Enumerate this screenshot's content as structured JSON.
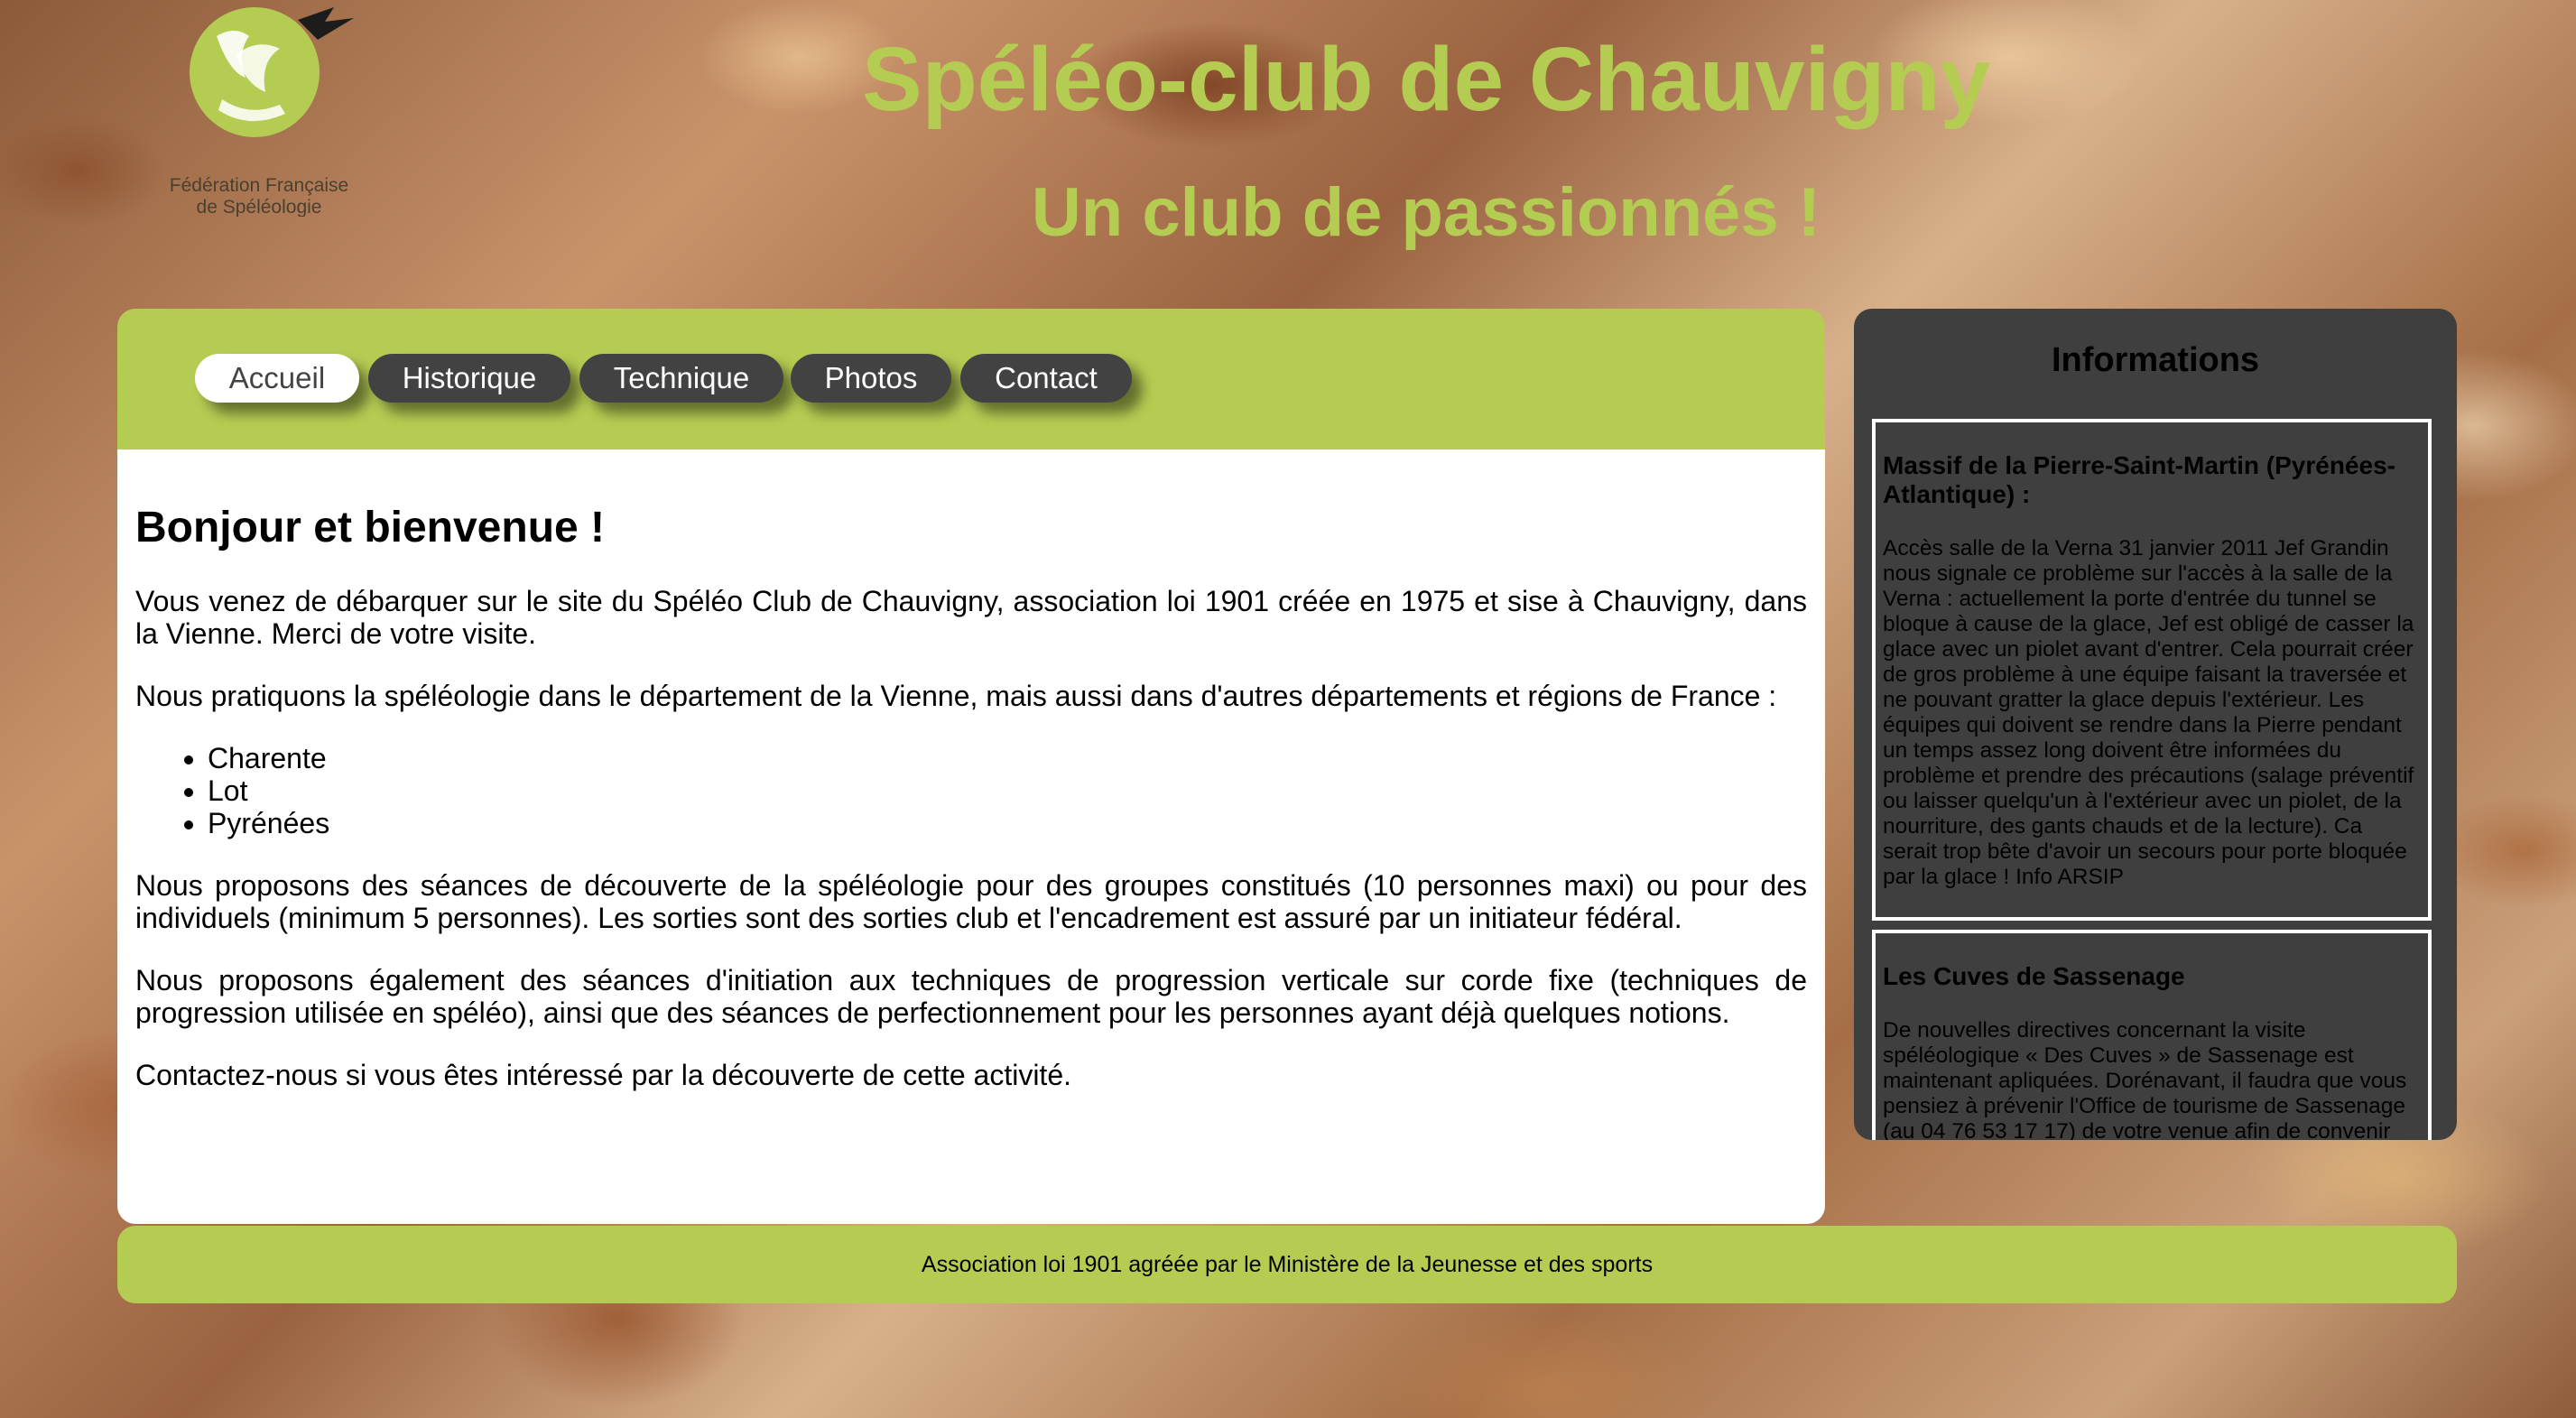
{
  "logo": {
    "text_line1": "Fédération Française",
    "text_line2": "de Spéléologie"
  },
  "header": {
    "title": "Spéléo-club de Chauvigny",
    "subtitle": "Un club de passionnés !"
  },
  "nav": {
    "items": [
      {
        "label": "Accueil",
        "active": true
      },
      {
        "label": "Historique",
        "active": false
      },
      {
        "label": "Technique",
        "active": false
      },
      {
        "label": "Photos",
        "active": false
      },
      {
        "label": "Contact",
        "active": false
      }
    ]
  },
  "main": {
    "heading": "Bonjour et bienvenue !",
    "paragraph1": "Vous venez de débarquer sur le site du Spéléo Club de Chauvigny, association loi 1901 créée en 1975 et sise à Chauvigny, dans la Vienne. Merci de votre visite.",
    "paragraph2": "Nous pratiquons la spéléologie dans le département de la Vienne, mais aussi dans d'autres départements et régions de France :",
    "regions": [
      "Charente",
      "Lot",
      "Pyrénées"
    ],
    "paragraph3": "Nous proposons des séances de découverte de la spéléologie pour des groupes constitués (10 personnes maxi) ou pour des individuels (minimum 5 personnes). Les sorties sont des sorties club et l'encadrement est assuré par un initiateur fédéral.",
    "paragraph4": "Nous proposons également des séances d'initiation aux techniques de progression verticale sur corde fixe (techniques de progression utilisée en spéléo), ainsi que des séances de perfectionnement pour les personnes ayant déjà quelques notions.",
    "paragraph5": "Contactez-nous si vous êtes intéressé par la découverte de cette activité."
  },
  "info": {
    "title": "Informations",
    "cards": [
      {
        "title": "Massif de la Pierre-Saint-Martin (Pyrénées-Atlantique) :",
        "body": "Accès salle de la Verna 31 janvier 2011 Jef Grandin nous signale ce problème sur l'accès à la salle de la Verna : actuellement la porte d'entrée du tunnel se bloque à cause de la glace, Jef est obligé de casser la glace avec un piolet avant d'entrer. Cela pourrait créer de gros problème à une équipe faisant la traversée et ne pouvant gratter la glace depuis l'extérieur. Les équipes qui doivent se rendre dans la Pierre pendant un temps assez long doivent être informées du problème et prendre des précautions (salage préventif ou laisser quelqu'un à l'extérieur avec un piolet, de la nourriture, des gants chauds et de la lecture). Ca serait trop bête d'avoir un secours pour porte bloquée par la glace ! Info ARSIP"
      },
      {
        "title": "Les Cuves de Sassenage",
        "body": "De nouvelles directives concernant la visite spéléologique « Des Cuves » de Sassenage est maintenant apliquées. Dorénavant, il faudra que vous pensiez à prévenir l'Office de tourisme de Sassenage (au 04 76 53 17 17) de votre venue afin de convenir d'un"
      }
    ]
  },
  "footer": {
    "text": "Association loi 1901 agréée par le Ministère de la Jeunesse et des sports"
  },
  "colors": {
    "accent_green": "#b5cc52",
    "dark_grey": "#424242",
    "panel_grey": "#3f3f3f"
  }
}
